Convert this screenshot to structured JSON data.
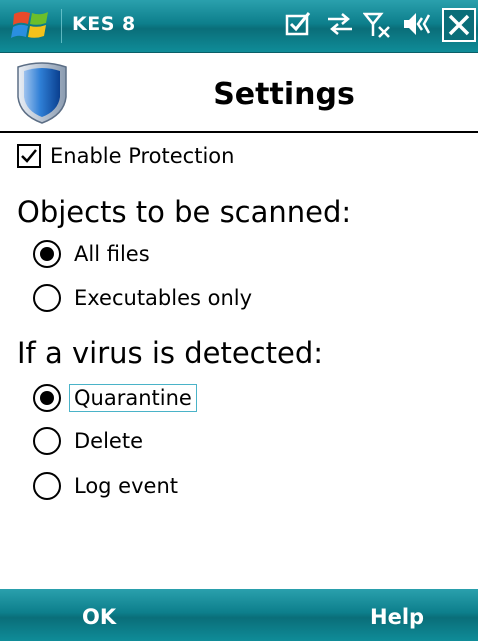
{
  "titlebar": {
    "app_title": "KES 8",
    "icons": [
      "windows-start-icon",
      "checklist-icon",
      "data-sync-icon",
      "no-signal-icon",
      "speaker-icon",
      "close-icon"
    ]
  },
  "header": {
    "title": "Settings",
    "logo": "shield-icon"
  },
  "enable_protection": {
    "label": "Enable Protection",
    "checked": true
  },
  "objects_section": {
    "title": "Objects to be scanned:",
    "options": [
      {
        "label": "All files",
        "selected": true
      },
      {
        "label": "Executables only",
        "selected": false
      }
    ]
  },
  "virus_section": {
    "title": "If a virus is detected:",
    "options": [
      {
        "label": "Quarantine",
        "selected": true
      },
      {
        "label": "Delete",
        "selected": false
      },
      {
        "label": "Log event",
        "selected": false
      }
    ]
  },
  "softkeys": {
    "left": "OK",
    "right": "Help"
  },
  "colors": {
    "bar": "#0d7f8c",
    "focus": "#4ab3c8"
  }
}
